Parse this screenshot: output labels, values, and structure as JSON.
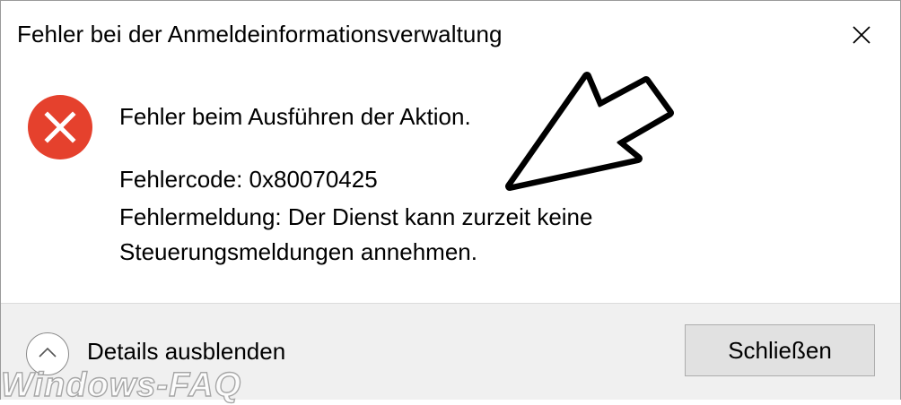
{
  "dialog": {
    "title": "Fehler bei der Anmeldeinformationsverwaltung",
    "close_icon": "close-icon"
  },
  "message": {
    "icon": "error-icon",
    "icon_color": "#e5412d",
    "main": "Fehler beim Ausführen der Aktion.",
    "code_line": "Fehlercode: 0x80070425",
    "error_line_1": "Fehlermeldung: Der Dienst kann zurzeit keine",
    "error_line_2": "Steuerungsmeldungen annehmen."
  },
  "annotation": {
    "icon": "pointer-arrow-icon"
  },
  "footer": {
    "toggle_icon": "chevron-up-icon",
    "toggle_label": "Details ausblenden",
    "close_button_label": "Schließen"
  },
  "watermark": {
    "text": "Windows-FAQ"
  }
}
